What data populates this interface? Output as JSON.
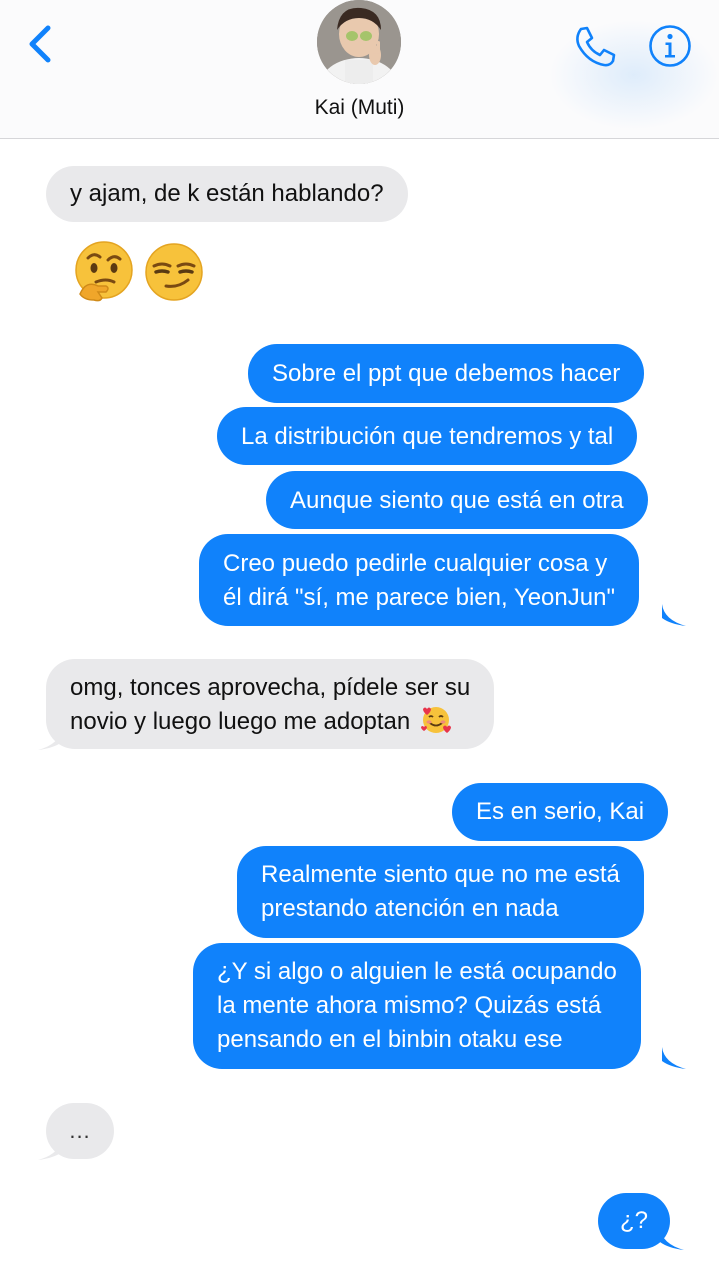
{
  "header": {
    "contact_name": "Kai (Muti)",
    "back_icon": "chevron-left-icon",
    "phone_icon": "phone-icon",
    "info_icon": "info-icon",
    "accent": "#1082fb"
  },
  "messages": [
    {
      "dir": "in",
      "lines": [
        "y ajam, de k están hablando?"
      ]
    },
    {
      "dir": "in",
      "emoji": [
        "thinking-face",
        "smirking-face"
      ]
    },
    {
      "dir": "out",
      "lines": [
        "Sobre el ppt que debemos hacer"
      ]
    },
    {
      "dir": "out",
      "lines": [
        "La distribución que tendremos y tal"
      ]
    },
    {
      "dir": "out",
      "lines": [
        "Aunque siento que está en otra"
      ]
    },
    {
      "dir": "out",
      "lines": [
        "Creo puedo pedirle cualquier cosa y",
        "él dirá \"sí, me parece bien, YeonJun\""
      ]
    },
    {
      "dir": "in",
      "lines": [
        "omg, tonces aprovecha, pídele ser su",
        "novio y luego luego me adoptan"
      ],
      "trailing_emoji": "smiling-face-with-hearts"
    },
    {
      "dir": "out",
      "lines": [
        "Es en serio, Kai"
      ]
    },
    {
      "dir": "out",
      "lines": [
        "Realmente siento que no me está",
        "prestando atención en nada"
      ]
    },
    {
      "dir": "out",
      "lines": [
        "¿Y si algo o alguien le está ocupando",
        "la mente ahora mismo? Quizás está",
        "pensando en el binbin otaku ese"
      ]
    },
    {
      "dir": "in",
      "lines": [
        "..."
      ]
    },
    {
      "dir": "out",
      "lines": [
        "¿?"
      ]
    }
  ],
  "colors": {
    "incoming_bubble": "#e9e9eb",
    "outgoing_bubble": "#1082fb"
  }
}
